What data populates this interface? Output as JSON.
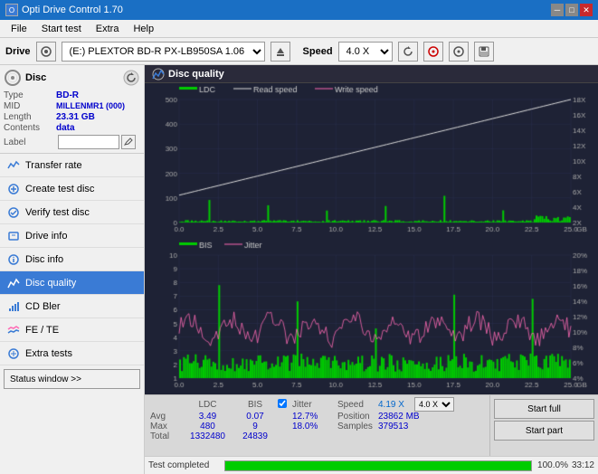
{
  "titleBar": {
    "appName": "Opti Drive Control 1.70",
    "minBtn": "─",
    "maxBtn": "□",
    "closeBtn": "✕"
  },
  "menuBar": {
    "items": [
      "File",
      "Start test",
      "Extra",
      "Help"
    ]
  },
  "driveBar": {
    "driveLabel": "Drive",
    "driveValue": "(E:)  PLEXTOR BD-R  PX-LB950SA 1.06",
    "speedLabel": "Speed",
    "speedValue": "4.0 X"
  },
  "disc": {
    "title": "Disc",
    "typeLabel": "Type",
    "typeValue": "BD-R",
    "midLabel": "MID",
    "midValue": "MILLENMR1 (000)",
    "lengthLabel": "Length",
    "lengthValue": "23.31 GB",
    "contentsLabel": "Contents",
    "contentsValue": "data",
    "labelLabel": "Label",
    "labelValue": ""
  },
  "navItems": [
    {
      "id": "transfer-rate",
      "label": "Transfer rate",
      "active": false
    },
    {
      "id": "create-test-disc",
      "label": "Create test disc",
      "active": false
    },
    {
      "id": "verify-test-disc",
      "label": "Verify test disc",
      "active": false
    },
    {
      "id": "drive-info",
      "label": "Drive info",
      "active": false
    },
    {
      "id": "disc-info",
      "label": "Disc info",
      "active": false
    },
    {
      "id": "disc-quality",
      "label": "Disc quality",
      "active": true
    },
    {
      "id": "cd-bler",
      "label": "CD Bler",
      "active": false
    },
    {
      "id": "fe-te",
      "label": "FE / TE",
      "active": false
    },
    {
      "id": "extra-tests",
      "label": "Extra tests",
      "active": false
    }
  ],
  "statusWindowBtn": "Status window >>",
  "discQualityTitle": "Disc quality",
  "chartColors": {
    "ldc": "#00cc00",
    "readSpeed": "#ffffff",
    "writeSpeed": "#ff69b4",
    "bis": "#00cc00",
    "jitter": "#ff69b4",
    "grid": "#333355",
    "background": "#1e2235"
  },
  "upperChart": {
    "legend": [
      "LDC",
      "Read speed",
      "Write speed"
    ],
    "yAxisLeft": [
      "500",
      "400",
      "300",
      "200",
      "100",
      "0"
    ],
    "yAxisRight": [
      "18X",
      "16X",
      "14X",
      "12X",
      "10X",
      "8X",
      "6X",
      "4X",
      "2X"
    ],
    "xAxis": [
      "0.0",
      "2.5",
      "5.0",
      "7.5",
      "10.0",
      "12.5",
      "15.0",
      "17.5",
      "20.0",
      "22.5",
      "25.0 GB"
    ]
  },
  "lowerChart": {
    "legend": [
      "BIS",
      "Jitter"
    ],
    "yAxisLeft": [
      "10",
      "9",
      "8",
      "7",
      "6",
      "5",
      "4",
      "3",
      "2",
      "1"
    ],
    "yAxisRight": [
      "20%",
      "18%",
      "16%",
      "14%",
      "12%",
      "10%",
      "8%",
      "6%",
      "4%"
    ],
    "xAxis": [
      "0.0",
      "2.5",
      "5.0",
      "7.5",
      "10.0",
      "12.5",
      "15.0",
      "17.5",
      "20.0",
      "22.5",
      "25.0 GB"
    ]
  },
  "statsTable": {
    "headers": [
      "",
      "LDC",
      "BIS",
      "",
      "Jitter",
      "Speed",
      "",
      ""
    ],
    "avgRow": {
      "label": "Avg",
      "ldc": "3.49",
      "bis": "0.07",
      "jitter": "12.7%"
    },
    "maxRow": {
      "label": "Max",
      "ldc": "480",
      "bis": "9",
      "jitter": "18.0%"
    },
    "totalRow": {
      "label": "Total",
      "ldc": "1332480",
      "bis": "24839"
    },
    "jitterChecked": true,
    "speedValue": "4.19 X",
    "speedLabel": "Speed",
    "speedSelectValue": "4.0 X",
    "positionLabel": "Position",
    "positionValue": "23862 MB",
    "samplesLabel": "Samples",
    "samplesValue": "379513"
  },
  "buttons": {
    "startFull": "Start full",
    "startPart": "Start part"
  },
  "bottomBar": {
    "statusText": "Test completed",
    "progressPercent": 100,
    "progressLabel": "100.0%",
    "timeText": "33:12"
  }
}
